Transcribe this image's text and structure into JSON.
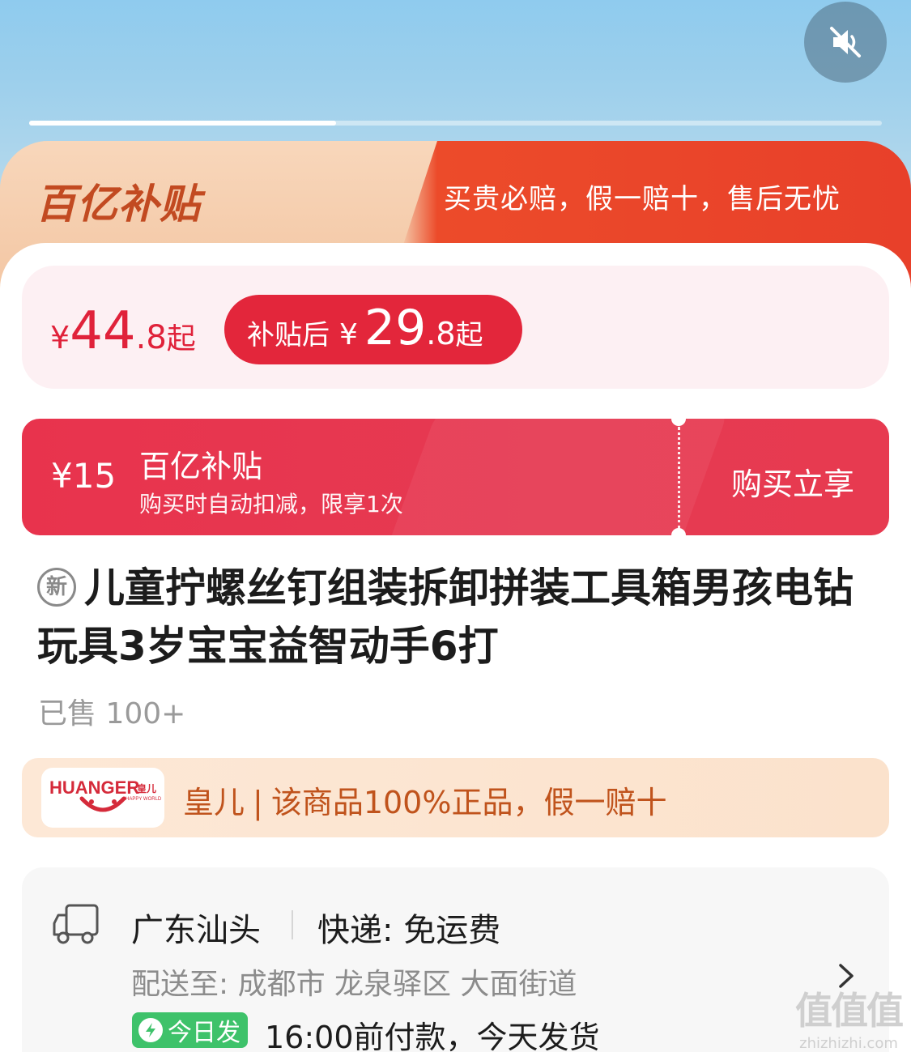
{
  "media": {
    "mute_icon": "speaker-muted-icon",
    "progress": 0.36
  },
  "banner": {
    "logo": "百亿补贴",
    "slogan": "买贵必赔，假一赔十，售后无忧"
  },
  "price": {
    "currency": "¥",
    "original_int": "44",
    "original_dec": ".8",
    "original_suffix": "起",
    "subsidy_label": "补贴后",
    "subsidy_int": "29",
    "subsidy_dec": ".8",
    "subsidy_suffix": "起"
  },
  "coupon": {
    "amount": "¥15",
    "title": "百亿补贴",
    "desc": "购买时自动扣减，限享1次",
    "action": "购买立享"
  },
  "product": {
    "new_badge": "新",
    "title": "儿童拧螺丝钉组装拆卸拼装工具箱男孩电钻玩具3岁宝宝益智动手6打",
    "sold": "已售 100+"
  },
  "brand": {
    "logo_text": "HUANGER",
    "logo_text_cn": "皇儿",
    "logo_sub": "HAPPY WORLD",
    "name": "皇儿",
    "separator": "|",
    "claim": "该商品100%正品，假一赔十"
  },
  "shipping": {
    "origin": "广东汕头",
    "method": "快递: 免运费",
    "destination": "配送至: 成都市 龙泉驿区 大面街道",
    "today_badge": "今日发",
    "note": "16:00前付款，今天发货"
  },
  "watermark": {
    "big": "值值值",
    "small": "zhizhizhi.com"
  },
  "colors": {
    "accent_red": "#e3263b",
    "banner_orange": "#e8402a",
    "brand_text": "#c0531c",
    "green": "#3ec26a"
  }
}
